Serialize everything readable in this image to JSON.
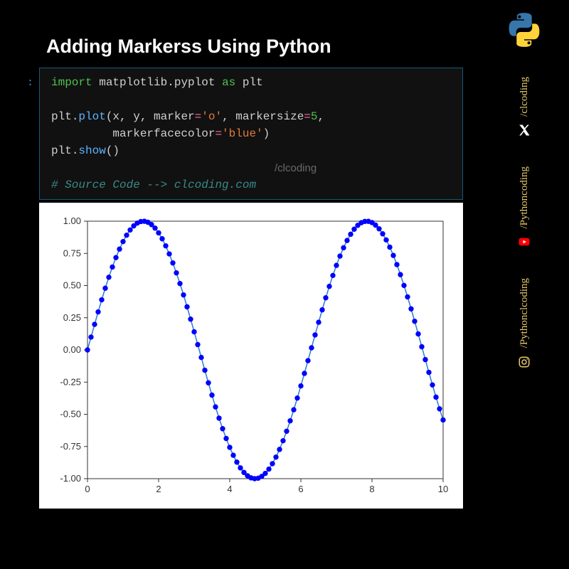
{
  "title": "Adding Markerss Using Python",
  "prompt": ":",
  "code": {
    "l1": {
      "kw": "import",
      "mod": "matplotlib.pyplot",
      "as": "as",
      "alias": "plt"
    },
    "l2": {
      "obj": "plt",
      "fn": "plot",
      "args": "(x, y, marker=",
      "s1": "'o'",
      "c": ", markersize=",
      "n1": "5",
      "end": ","
    },
    "l3": {
      "indent": "         markerfacecolor=",
      "s1": "'blue'",
      "end": ")"
    },
    "l4": {
      "obj": "plt",
      "fn": "show",
      "end": "()"
    },
    "comment": "# Source Code --> clcoding.com"
  },
  "watermark": "/clcoding",
  "socials": {
    "x": "/clcoding",
    "youtube": "/Pythoncoding",
    "instagram": "/Pythonclcoding"
  },
  "chart_data": {
    "type": "line",
    "title": "",
    "xlabel": "",
    "ylabel": "",
    "xlim": [
      0,
      10
    ],
    "ylim": [
      -1.0,
      1.0
    ],
    "xticks": [
      0,
      2,
      4,
      6,
      8,
      10
    ],
    "yticks": [
      -1.0,
      -0.75,
      -0.5,
      -0.25,
      0.0,
      0.25,
      0.5,
      0.75,
      1.0
    ],
    "marker": "o",
    "markersize": 5,
    "markerfacecolor": "blue",
    "linecolor": "#2a7ad4",
    "x": [
      0.0,
      0.1,
      0.2,
      0.3,
      0.4,
      0.5,
      0.6,
      0.7,
      0.8,
      0.9,
      1.0,
      1.1,
      1.2,
      1.3,
      1.4,
      1.5,
      1.6,
      1.7,
      1.8,
      1.9,
      2.0,
      2.1,
      2.2,
      2.3,
      2.4,
      2.5,
      2.6,
      2.7,
      2.8,
      2.9,
      3.0,
      3.1,
      3.2,
      3.3,
      3.4,
      3.5,
      3.6,
      3.7,
      3.8,
      3.9,
      4.0,
      4.1,
      4.2,
      4.3,
      4.4,
      4.5,
      4.6,
      4.7,
      4.8,
      4.9,
      5.0,
      5.1,
      5.2,
      5.3,
      5.4,
      5.5,
      5.6,
      5.7,
      5.8,
      5.9,
      6.0,
      6.1,
      6.2,
      6.3,
      6.4,
      6.5,
      6.6,
      6.7,
      6.8,
      6.9,
      7.0,
      7.1,
      7.2,
      7.3,
      7.4,
      7.5,
      7.6,
      7.7,
      7.8,
      7.9,
      8.0,
      8.1,
      8.2,
      8.3,
      8.4,
      8.5,
      8.6,
      8.7,
      8.8,
      8.9,
      9.0,
      9.1,
      9.2,
      9.3,
      9.4,
      9.5,
      9.6,
      9.7,
      9.8,
      9.9,
      10.0
    ],
    "y": [
      0.0,
      0.0998,
      0.1987,
      0.2955,
      0.3894,
      0.4794,
      0.5646,
      0.6442,
      0.7174,
      0.7833,
      0.8415,
      0.8912,
      0.932,
      0.9636,
      0.9854,
      0.9975,
      0.9996,
      0.9917,
      0.9738,
      0.9463,
      0.9093,
      0.8632,
      0.8085,
      0.7457,
      0.6755,
      0.5985,
      0.5155,
      0.4274,
      0.335,
      0.2392,
      0.1411,
      0.0416,
      -0.0584,
      -0.1577,
      -0.2555,
      -0.3508,
      -0.4425,
      -0.5298,
      -0.6119,
      -0.6878,
      -0.7568,
      -0.8183,
      -0.8716,
      -0.9162,
      -0.9516,
      -0.9775,
      -0.9937,
      -0.9999,
      -0.9962,
      -0.9825,
      -0.9589,
      -0.9258,
      -0.8835,
      -0.8323,
      -0.7728,
      -0.7055,
      -0.6313,
      -0.5507,
      -0.4646,
      -0.3739,
      -0.2794,
      -0.1822,
      -0.0831,
      0.0168,
      0.1165,
      0.215,
      0.3115,
      0.4048,
      0.494,
      0.5784,
      0.657,
      0.729,
      0.7937,
      0.8504,
      0.8987,
      0.938,
      0.9679,
      0.9882,
      0.9985,
      0.9989,
      0.9894,
      0.9699,
      0.9407,
      0.9022,
      0.8546,
      0.7985,
      0.7344,
      0.663,
      0.585,
      0.501,
      0.4121,
      0.3191,
      0.2229,
      0.1245,
      0.0248,
      -0.0752,
      -0.1743,
      -0.2718,
      -0.3665,
      -0.4575,
      -0.544
    ]
  }
}
